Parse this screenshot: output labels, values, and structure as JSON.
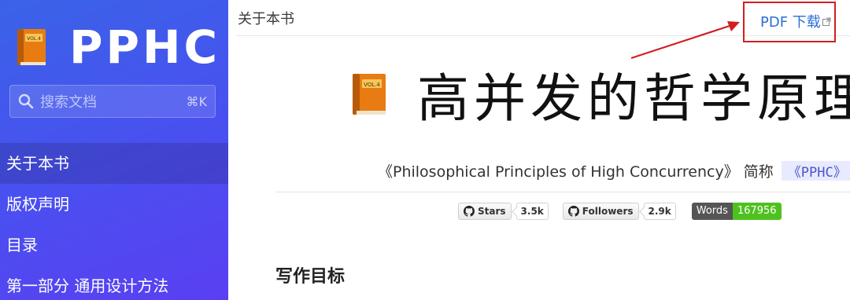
{
  "sidebar": {
    "brand": "PPHC",
    "search": {
      "placeholder": "搜索文档",
      "shortcut": "⌘K"
    },
    "items": [
      {
        "label": "关于本书",
        "active": true
      },
      {
        "label": "版权声明",
        "active": false
      },
      {
        "label": "目录",
        "active": false
      },
      {
        "label": "第一部分 通用设计方法",
        "active": false
      }
    ]
  },
  "topbar": {
    "breadcrumb": "关于本书",
    "pdf_link": "PDF 下载"
  },
  "content": {
    "title": "高并发的哲学原理",
    "subtitle": "《Philosophical Principles of High Concurrency》 简称",
    "abbreviation": "《PPHC》",
    "badges": [
      {
        "label": "Stars",
        "count": "3.5k",
        "icon": "github-icon"
      },
      {
        "label": "Followers",
        "count": "2.9k",
        "icon": "github-icon"
      }
    ],
    "words_badge": {
      "label": "Words",
      "value": "167956"
    },
    "section_heading": "写作目标"
  },
  "icons": {
    "book": "orange-book-icon",
    "book_spine_text": "VOL.4",
    "search": "search-icon",
    "external": "external-link-icon"
  },
  "colors": {
    "sidebar_gradient_start": "#3a63e8",
    "sidebar_gradient_end": "#5a3ff2",
    "link": "#2b6fd6",
    "highlight_box": "#d21f1f",
    "words_value_bg": "#4ec11f"
  }
}
